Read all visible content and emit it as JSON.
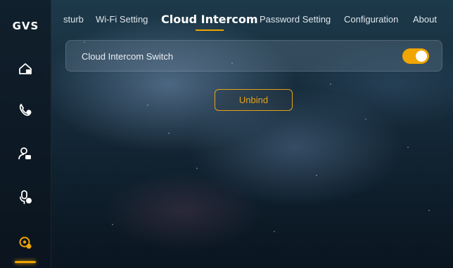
{
  "brand": {
    "logo_text": "GVS",
    "accent_color": "#f0a500"
  },
  "sidebar": {
    "items": [
      {
        "icon": "home-icon",
        "active": false
      },
      {
        "icon": "phone-call-icon",
        "active": false
      },
      {
        "icon": "user-camera-icon",
        "active": false
      },
      {
        "icon": "microphone-settings-icon",
        "active": false
      },
      {
        "icon": "settings-gear-icon",
        "active": true
      }
    ]
  },
  "tabs": [
    {
      "label": "sturb",
      "active": false
    },
    {
      "label": "Wi-Fi Setting",
      "active": false
    },
    {
      "label": "Cloud Intercom",
      "active": true
    },
    {
      "label": "Password Setting",
      "active": false
    },
    {
      "label": "Configuration",
      "active": false
    },
    {
      "label": "About",
      "active": false
    }
  ],
  "cloud_intercom": {
    "switch_label": "Cloud Intercom Switch",
    "switch_on": true,
    "unbind_label": "Unbind"
  }
}
